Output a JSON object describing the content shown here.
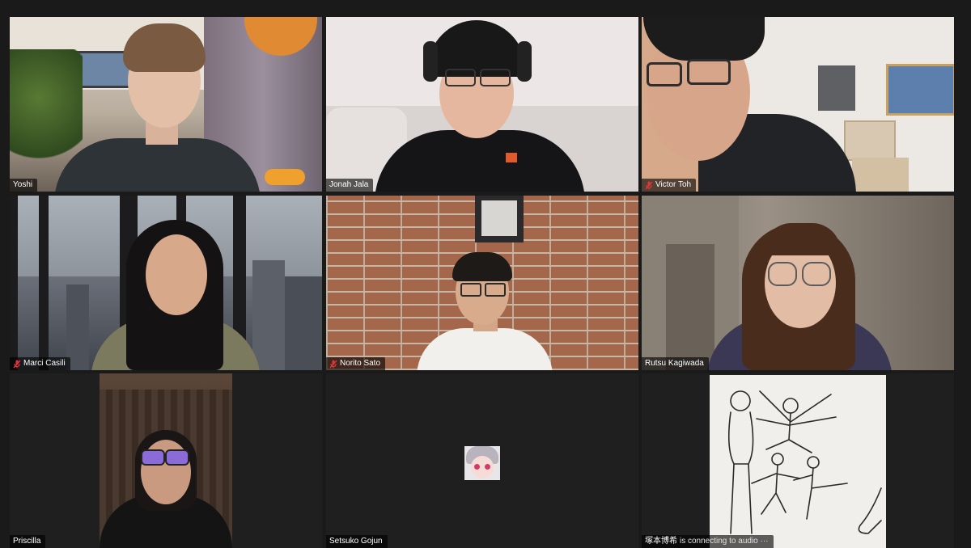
{
  "participants": [
    {
      "name": "Yoshi",
      "muted": false
    },
    {
      "name": "Jonah Jala",
      "muted": false
    },
    {
      "name": "Victor Toh",
      "muted": true
    },
    {
      "name": "Marci Casili",
      "muted": true
    },
    {
      "name": "Norito Sato",
      "muted": true
    },
    {
      "name": "Rutsu Kagiwada",
      "muted": false
    },
    {
      "name": "Priscilla",
      "muted": false,
      "speaking": true
    },
    {
      "name": "Setsuko Gojun",
      "muted": false,
      "video_off": true
    },
    {
      "name": "塚本博希",
      "status": "is connecting to audio ···",
      "muted": false
    }
  ],
  "colors": {
    "background": "#1a1a1a",
    "active_speaker_border": "#b6d83c",
    "mute_icon": "#e0363b",
    "name_tag_bg": "rgba(0,0,0,0.62)"
  },
  "icons": {
    "mute": "mic-muted-icon"
  }
}
